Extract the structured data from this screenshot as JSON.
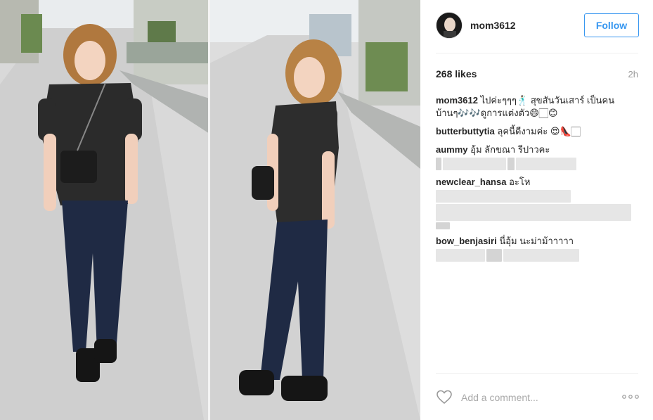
{
  "post": {
    "username": "mom3612",
    "follow_label": "Follow",
    "likes": "268 likes",
    "time_ago": "2h"
  },
  "comments": [
    {
      "user": "mom3612",
      "text": "ไปค่ะๆๆๆ🕺🏻 สุขสันวันเสาร์ เป็นคนบ้านๆ🎶🎶ดูการแต่งตัว😄🏻😊"
    },
    {
      "user": "butterbuttytia",
      "text": "ลุคนี้ดีงามค่ะ 😍👠🏻"
    },
    {
      "user": "aummy",
      "text": "อุ้ม ลักขณา รีปาวคะ"
    },
    {
      "user": "newclear_hansa",
      "text": "อะโห"
    },
    {
      "user": "bow_benjasiri",
      "text": "นี่อุ้ม นะม่าม้าาาาา"
    }
  ],
  "add_comment": {
    "placeholder": "Add a comment..."
  },
  "icons": {
    "heart": "heart-icon",
    "more": "more-options-icon",
    "avatar": "profile-avatar"
  },
  "colors": {
    "accent": "#3897f0",
    "muted": "#999999",
    "divider": "#efefef"
  }
}
